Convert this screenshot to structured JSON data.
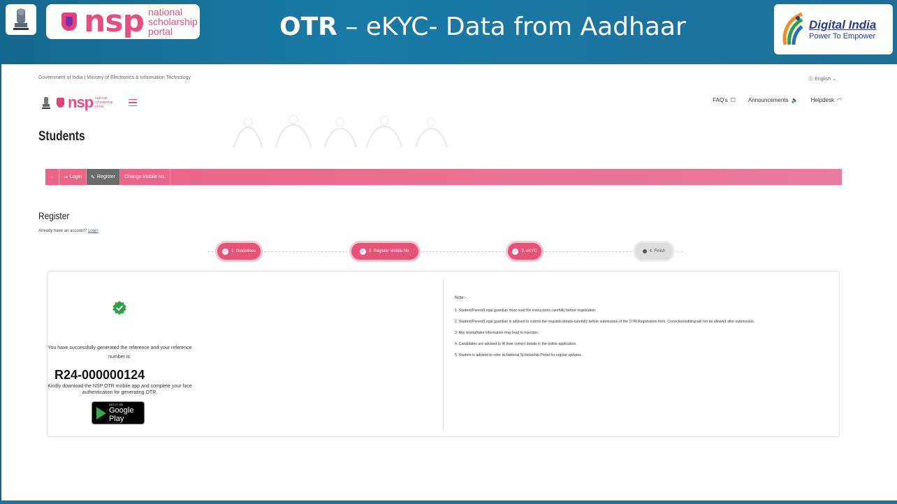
{
  "slide": {
    "title_bold": "OTR",
    "title_rest": " – eKYC- Data from Aadhaar",
    "nsp_logo_word": "nsp",
    "nsp_logo_sub_1": "national",
    "nsp_logo_sub_2": "scholarship",
    "nsp_logo_sub_3": "portal",
    "digital_india_title": "Digital India",
    "digital_india_tagline": "Power To Empower",
    "colors": {
      "header_bg": "#1a7aa6",
      "accent_pink": "#e64d82"
    }
  },
  "site": {
    "gov_strip_left": "Government of India | Ministry of Electronics & Information Technology",
    "gov_strip_lang": "English",
    "header_links": [
      "FAQ's",
      "Announcements",
      "Helpdesk"
    ],
    "page_heading": "Students",
    "nav_items": [
      {
        "label": "←",
        "icon": "back-arrow-icon"
      },
      {
        "label": "Login",
        "icon": "login-icon"
      },
      {
        "label": "Register",
        "icon": "edit-icon",
        "active": true
      },
      {
        "label": "Change Mobile no.",
        "icon": ""
      }
    ],
    "register_title": "Register",
    "already_text": "Already have an account?",
    "already_link": "Login",
    "steps": [
      {
        "label": "1. Guidelines",
        "state": "done"
      },
      {
        "label": "2. Register Mobile No.",
        "state": "done"
      },
      {
        "label": "3. eKYC",
        "state": "done"
      },
      {
        "label": "4. Finish",
        "state": "pending"
      }
    ],
    "success_message": "You have successfully generated the reference and your reference number is:",
    "reference_number": "R24-000000124",
    "download_message": "Kindly download the NSP OTR mobile app and complete your face authentication for generating OTR.",
    "google_play_small": "GET IT ON",
    "google_play_big": "Google Play",
    "note_heading": "Note:-",
    "notes": [
      "1. Student/Parent/Legal guardian must read the instructions carefully before registration.",
      "2. Student/Parent/Legal guardian is advised to submit the requisite details carefully before submission of the OTR Registration form. Correction/editing will not be allowed after submission.",
      "3. Any wrong/false information may lead to rejection.",
      "4. Candidates are advised to fill their correct details in the online application.",
      "5. Student is advised to refer to National Scholarship Portal for regular updates."
    ]
  }
}
